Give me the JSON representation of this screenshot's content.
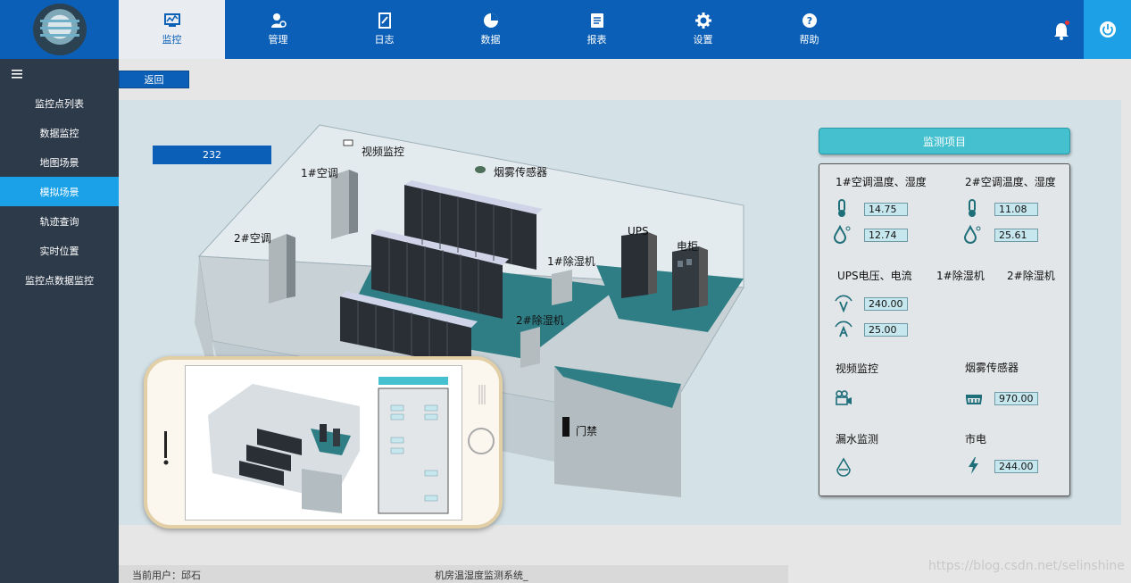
{
  "nav": [
    {
      "label": "监控",
      "icon": "monitor-chart-icon",
      "active": true
    },
    {
      "label": "管理",
      "icon": "user-settings-icon"
    },
    {
      "label": "日志",
      "icon": "log-book-icon"
    },
    {
      "label": "数据",
      "icon": "pie-chart-icon"
    },
    {
      "label": "报表",
      "icon": "report-icon"
    },
    {
      "label": "设置",
      "icon": "gear-icon"
    },
    {
      "label": "帮助",
      "icon": "help-icon"
    }
  ],
  "sidebar": {
    "items": [
      {
        "label": "监控点列表"
      },
      {
        "label": "数据监控"
      },
      {
        "label": "地图场景"
      },
      {
        "label": "模拟场景",
        "active": true
      },
      {
        "label": "轨迹查询"
      },
      {
        "label": "实时位置"
      },
      {
        "label": "监控点数据监控"
      }
    ]
  },
  "toolbar": {
    "back_label": "返回"
  },
  "scene": {
    "counter": "232",
    "labels": {
      "video": "视频监控",
      "smoke": "烟雾传感器",
      "ac1": "1#空调",
      "ac2": "2#空调",
      "ups": "UPS",
      "cabinet": "电柜",
      "dehum1": "1#除湿机",
      "dehum2": "2#除湿机",
      "door": "门禁"
    }
  },
  "monitor": {
    "title": "监测项目",
    "ac1_title": "1#空调温度、湿度",
    "ac2_title": "2#空调温度、湿度",
    "ac1_temp": "14.75",
    "ac1_hum": "12.74",
    "ac2_temp": "11.08",
    "ac2_hum": "25.61",
    "ups_title": "UPS电压、电流",
    "dehum1_title": "1#除湿机",
    "dehum2_title": "2#除湿机",
    "ups_voltage": "240.00",
    "ups_current": "25.00",
    "video_title": "视频监控",
    "smoke_title": "烟雾传感器",
    "smoke_value": "970.00",
    "leak_title": "漏水监测",
    "mains_title": "市电",
    "mains_value": "244.00"
  },
  "status": {
    "user": "当前用户：邱石",
    "system": "机房温湿度监测系统_"
  },
  "watermark": "https://blog.csdn.net/selinshine",
  "colors": {
    "header": "#0b5fb6",
    "sidebar": "#2d3a4a",
    "active": "#1aa1e8",
    "accent": "#45c0cf"
  }
}
